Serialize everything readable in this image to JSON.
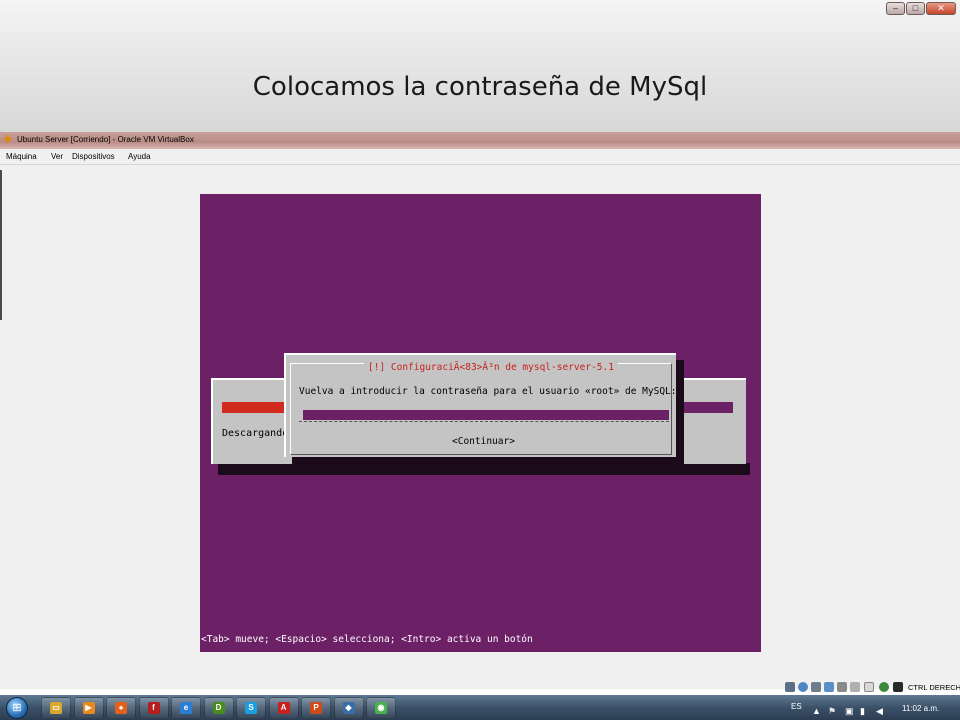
{
  "slide": {
    "title": "Colocamos la contraseña de MySql"
  },
  "window": {
    "title": "Ubuntu Server [Corriendo] - Oracle VM VirtualBox",
    "menu": [
      {
        "label": "Máquina"
      },
      {
        "label": "Ver"
      },
      {
        "label": "Dispositivos"
      },
      {
        "label": "Ayuda"
      }
    ],
    "controls": {
      "minimize": "–",
      "maximize": "□",
      "close": "✕"
    }
  },
  "installer": {
    "background_status": "Descargando",
    "dialog_title": "[!] ConfiguraciÃ<83>Â³n de mysql-server-5.1",
    "prompt": "Vuelva a introducir la contraseña para el usuario «root» de MySQL:",
    "password_value": "",
    "continue_label": "<Continuar>",
    "hint": "<Tab> mueve; <Espacio> selecciona; <Intro> activa un botón"
  },
  "statusbar": {
    "host_key": "CTRL DERECHA"
  },
  "taskbar": {
    "apps": [
      {
        "icon": "folder-icon",
        "color": "#d9a82a"
      },
      {
        "icon": "media-player-icon",
        "color": "#e8891c"
      },
      {
        "icon": "firefox-icon",
        "color": "#e2621b"
      },
      {
        "icon": "flash-icon",
        "color": "#b61d1d"
      },
      {
        "icon": "internet-explorer-icon",
        "color": "#2a7fd4"
      },
      {
        "icon": "dreamweaver-icon",
        "color": "#4a8c1c"
      },
      {
        "icon": "skype-icon",
        "color": "#1aa0e0"
      },
      {
        "icon": "acrobat-icon",
        "color": "#c81f1f"
      },
      {
        "icon": "powerpoint-icon",
        "color": "#d04a1c"
      },
      {
        "icon": "virtualbox-icon",
        "color": "#3a6ea8"
      },
      {
        "icon": "chrome-icon",
        "color": "#4caf50"
      }
    ],
    "language": "ES",
    "clock": "11:02 a.m."
  }
}
